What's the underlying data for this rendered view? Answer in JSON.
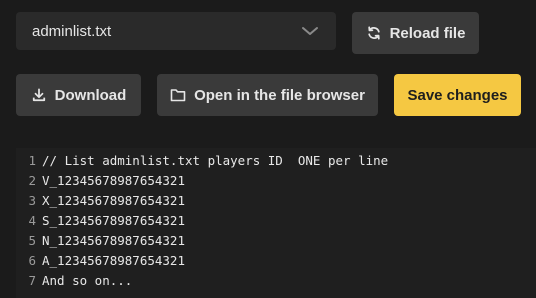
{
  "file_select": {
    "value": "adminlist.txt"
  },
  "toolbar": {
    "reload_label": "Reload file",
    "download_label": "Download",
    "browser_label": "Open in the file browser",
    "save_label": "Save changes"
  },
  "colors": {
    "background": "#1b1b1b",
    "control_bg": "#2a2a2a",
    "button_bg": "#3a3a3a",
    "accent": "#f5c842",
    "text": "#e6e6e6"
  },
  "icons": {
    "chevron": "chevron-down-icon",
    "reload": "reload-icon",
    "download": "download-icon",
    "folder": "folder-icon"
  },
  "editor": {
    "lines": [
      {
        "num": "1",
        "text": "// List adminlist.txt players ID  ONE per line"
      },
      {
        "num": "2",
        "text": "V_12345678987654321"
      },
      {
        "num": "3",
        "text": "X_12345678987654321"
      },
      {
        "num": "4",
        "text": "S_12345678987654321"
      },
      {
        "num": "5",
        "text": "N_12345678987654321"
      },
      {
        "num": "6",
        "text": "A_12345678987654321"
      },
      {
        "num": "7",
        "text": "And so on..."
      }
    ]
  }
}
